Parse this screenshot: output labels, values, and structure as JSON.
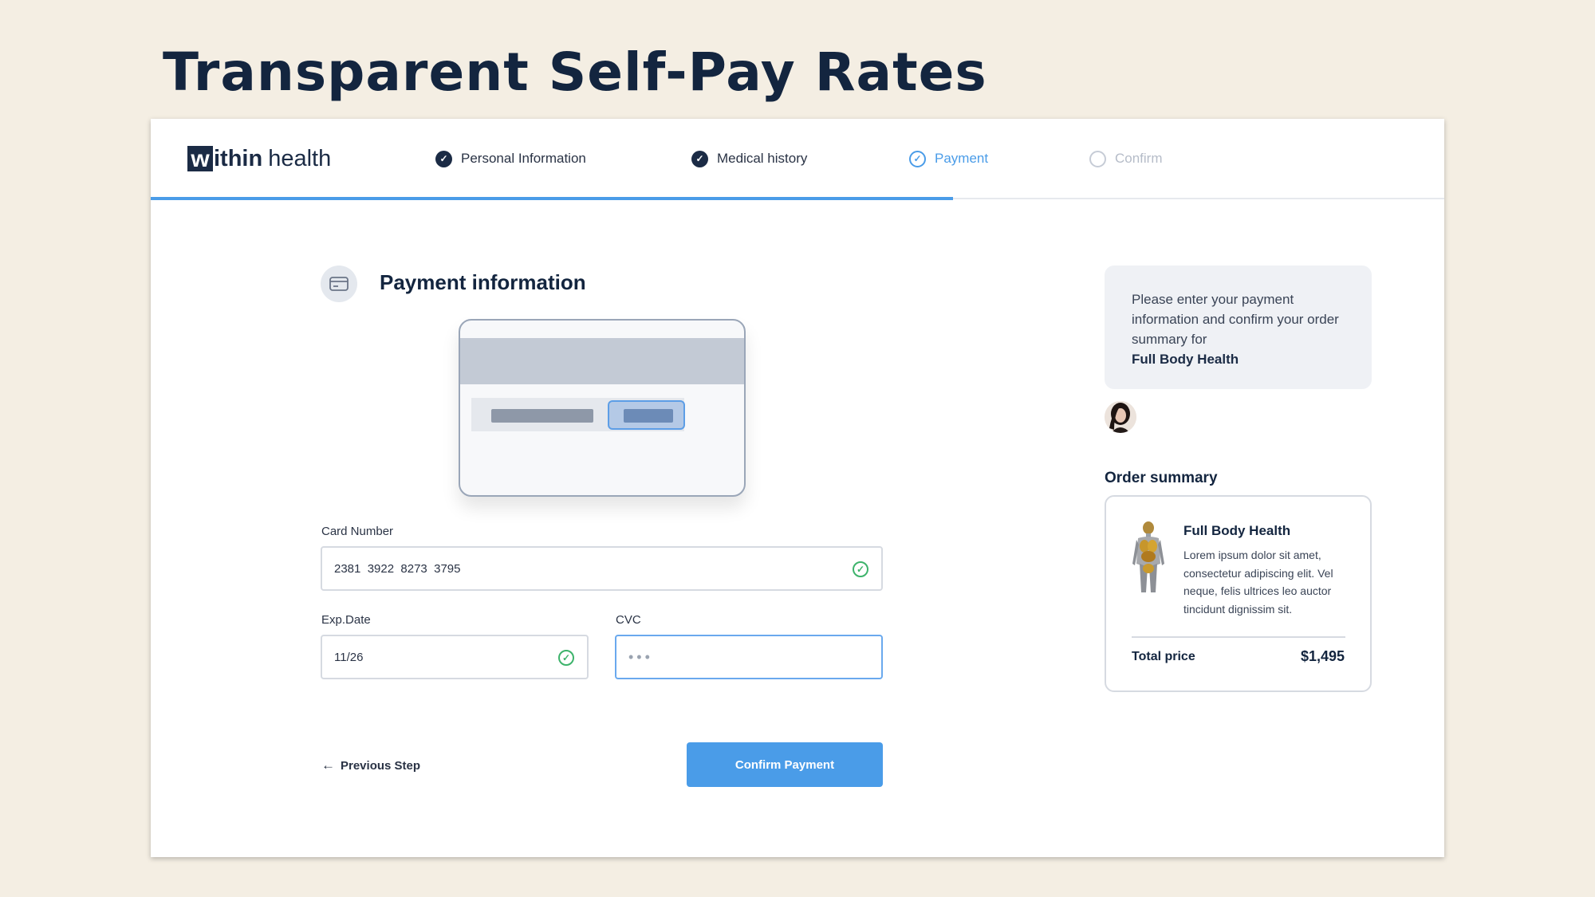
{
  "slide": {
    "title": "Transparent Self-Pay Rates"
  },
  "app": {
    "logo_initial": "w",
    "logo_rest": "ithin",
    "logo_health": "health"
  },
  "stepper": {
    "steps": [
      {
        "label": "Personal Information",
        "state": "complete"
      },
      {
        "label": "Medical history",
        "state": "complete"
      },
      {
        "label": "Payment",
        "state": "active"
      },
      {
        "label": "Confirm",
        "state": "pending"
      }
    ],
    "progress": 0.62
  },
  "payment": {
    "heading": "Payment information",
    "card_number_label": "Card Number",
    "card_number_value": "2381  3922  8273  3795",
    "exp_label": "Exp.Date",
    "exp_value": "11/26",
    "cvc_label": "CVC",
    "cvc_value": "•••",
    "previous_label": "Previous Step",
    "confirm_label": "Confirm Payment"
  },
  "sidebar": {
    "info_text": "Please enter your payment information and confirm your order summary for",
    "info_product": "Full Body Health",
    "order_title": "Order summary",
    "product_name": "Full Body Health",
    "product_desc": "Lorem ipsum dolor sit amet, consectetur adipiscing elit. Vel neque, felis ultrices leo auctor tincidunt dignissim sit.",
    "total_label": "Total price",
    "total_value": "$1,495"
  },
  "colors": {
    "accent": "#4a9ce8",
    "navy": "#1b2b45",
    "success": "#3db36b",
    "background": "#f4eee3"
  }
}
